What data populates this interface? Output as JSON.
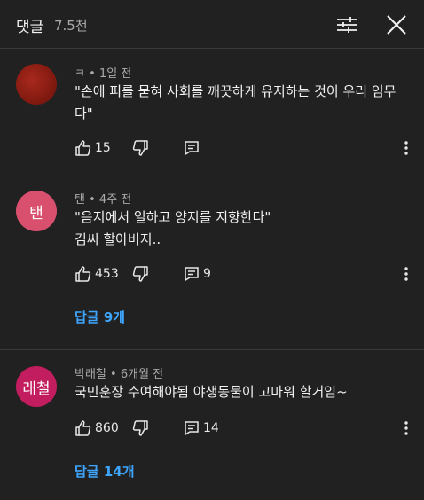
{
  "header": {
    "title": "댓글",
    "count": "7.5천",
    "filter_icon": "sliders-icon",
    "close_icon": "close-icon"
  },
  "comments": [
    {
      "author": "ㅋ",
      "time": "1일 전",
      "lines": [
        "\"손에 피를 묻혀 사회를 깨끗하게 유지하는 것이 우리 임무",
        "다\""
      ],
      "likes": "15",
      "replies_count": "",
      "avatar_color": "#8a1a10"
    },
    {
      "author": "탠",
      "time": "4주 전",
      "avatar_text": "탠",
      "lines": [
        "\"음지에서 일하고 양지를 지향한다\"",
        "김씨 할아버지.."
      ],
      "likes": "453",
      "replies_count": "9",
      "replies_link": "답글 9개",
      "avatar_color": "#d9506e"
    },
    {
      "author": "박래철",
      "time": "6개월 전",
      "avatar_text": "래철",
      "lines": [
        "국민훈장 수여해야됨 야생동물이 고마워 할거임~"
      ],
      "likes": "860",
      "replies_count": "14",
      "replies_link": "답글 14개",
      "avatar_color": "#c21d5e"
    }
  ],
  "separator": "•",
  "icons": {
    "like": "thumbs-up-icon",
    "dislike": "thumbs-down-icon",
    "reply": "reply-icon",
    "more": "more-vertical-icon"
  },
  "colors": {
    "background": "#212121",
    "link": "#3ea6ff",
    "muted": "#aaaaaa"
  }
}
